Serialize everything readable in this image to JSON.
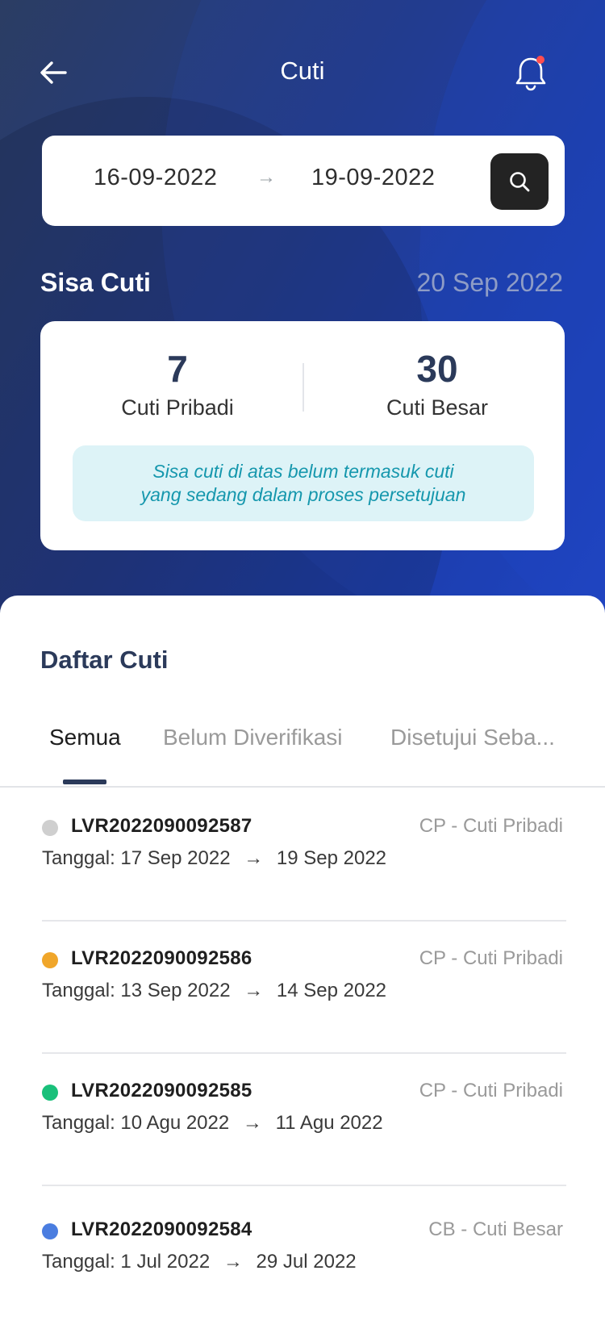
{
  "header": {
    "title": "Cuti"
  },
  "date_filter": {
    "from": "16-09-2022",
    "to": "19-09-2022",
    "arrow": "→"
  },
  "sisa": {
    "label": "Sisa Cuti",
    "date": "20 Sep 2022",
    "pribadi_value": "7",
    "pribadi_label": "Cuti Pribadi",
    "besar_value": "30",
    "besar_label": "Cuti Besar",
    "note_line1": "Sisa cuti di atas belum termasuk cuti",
    "note_line2": "yang sedang dalam proses persetujuan"
  },
  "list": {
    "title": "Daftar Cuti",
    "tabs": [
      "Semua",
      "Belum Diverifikasi",
      "Disetujui Seba..."
    ],
    "items": [
      {
        "code": "LVR2022090092587",
        "type": "CP - Cuti Pribadi",
        "prefix": "Tanggal:",
        "start": "17 Sep 2022",
        "end": "19 Sep 2022",
        "status_color": "#cfcfcf"
      },
      {
        "code": "LVR2022090092586",
        "type": "CP - Cuti Pribadi",
        "prefix": "Tanggal:",
        "start": "13 Sep 2022",
        "end": "14 Sep 2022",
        "status_color": "#f0a62a"
      },
      {
        "code": "LVR2022090092585",
        "type": "CP - Cuti Pribadi",
        "prefix": "Tanggal:",
        "start": "10 Agu 2022",
        "end": "11 Agu 2022",
        "status_color": "#19c07a"
      },
      {
        "code": "LVR2022090092584",
        "type": "CB - Cuti Besar",
        "prefix": "Tanggal:",
        "start": "1 Jul 2022",
        "end": "29 Jul 2022",
        "status_color": "#4a7de0"
      }
    ]
  },
  "colors": {
    "accent": "#2b3a5a",
    "notice_bg": "#ddf3f7",
    "notice_text": "#1597ad",
    "notification_dot": "#ff4d4f"
  },
  "icons": [
    "back-arrow-icon",
    "bell-icon",
    "search-icon",
    "arrow-right-icon"
  ]
}
